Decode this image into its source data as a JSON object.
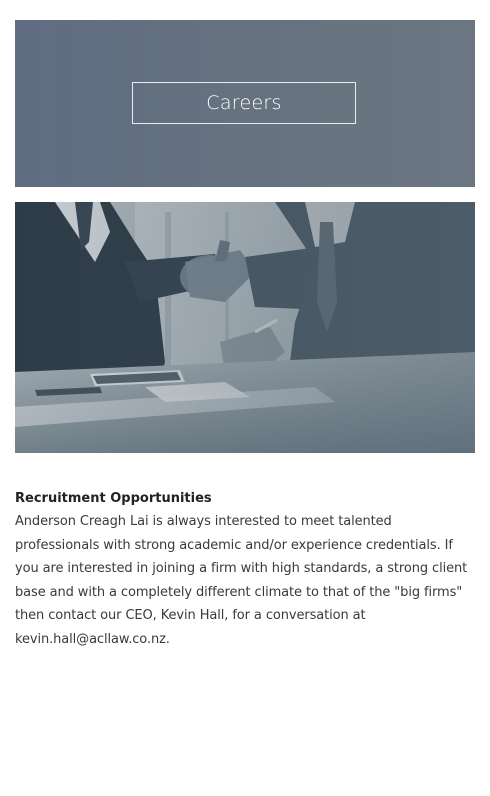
{
  "hero": {
    "button_label": "Careers"
  },
  "photo": {
    "alt": "handshake"
  },
  "content": {
    "title": "Recruitment Opportunities",
    "body": "Anderson Creagh Lai is always interested to meet talented professionals with strong academic and/or experience credentials. If you are interested in joining a firm with high standards, a strong client base and with a completely different climate to that of the \"big firms\" then contact our CEO, Kevin Hall, for a conversation at kevin.hall@acllaw.co.nz."
  },
  "colors": {
    "hero_background": "#637085",
    "text": "#333333"
  }
}
